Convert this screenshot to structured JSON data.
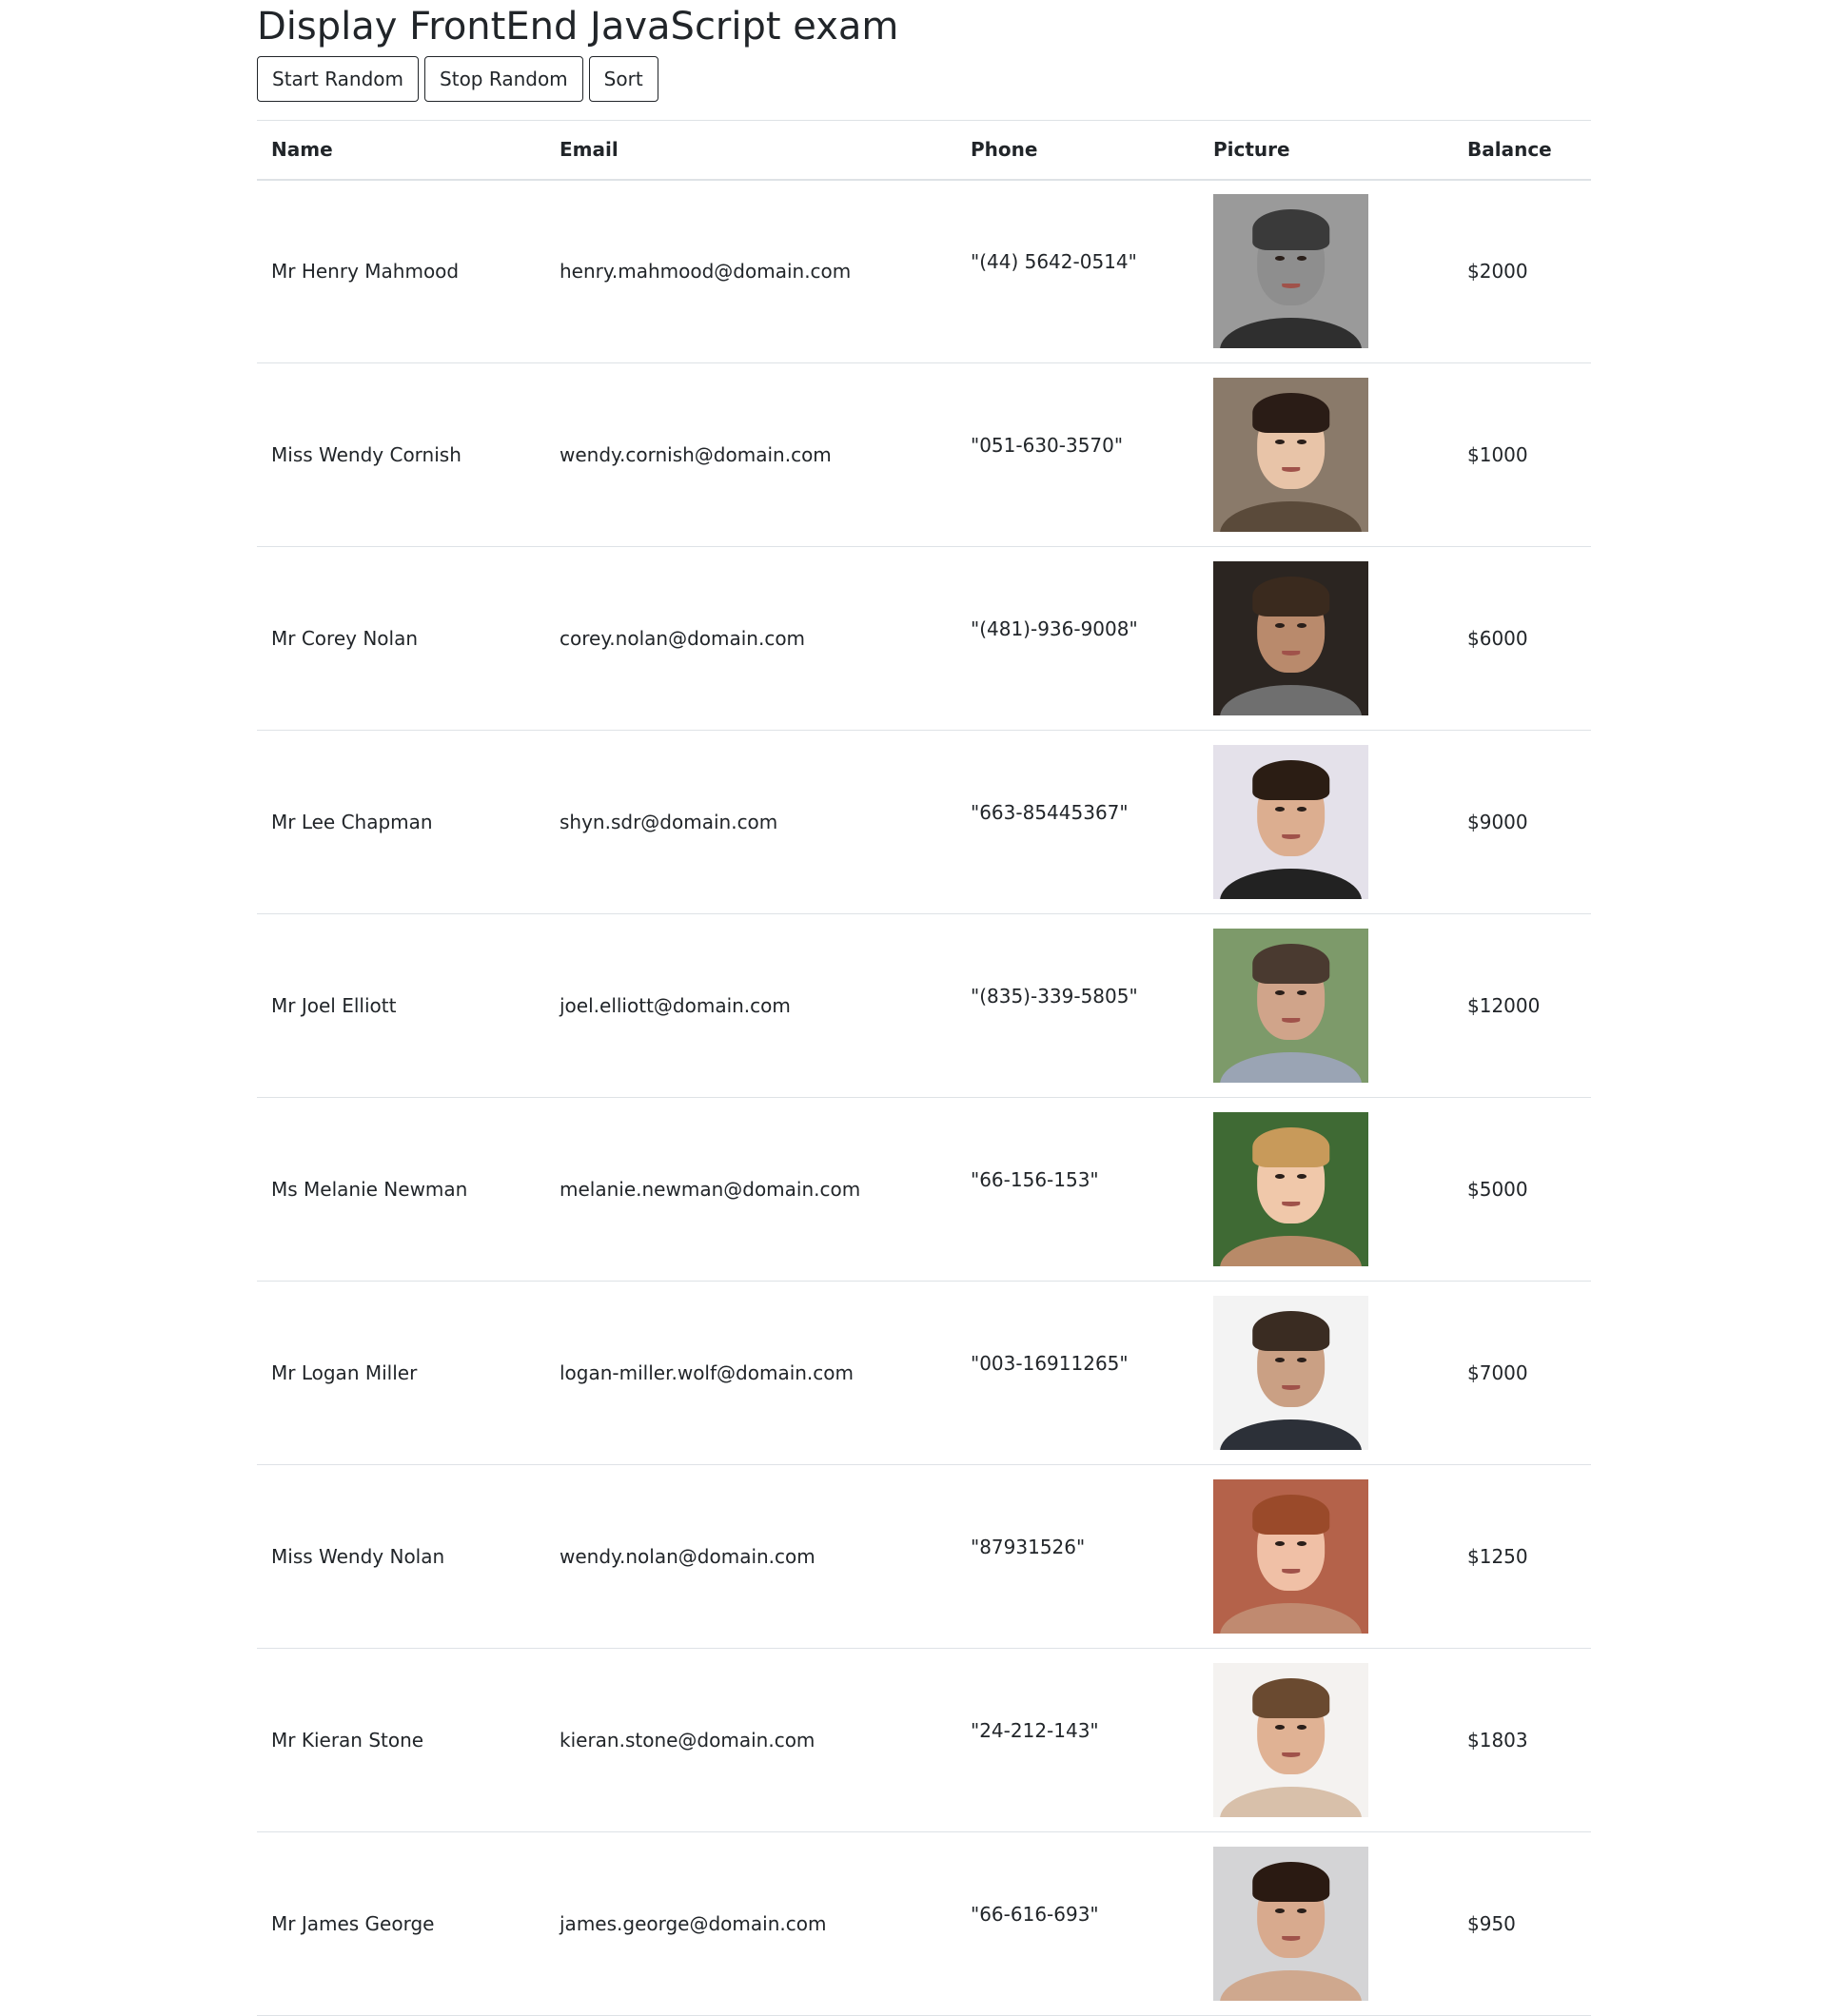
{
  "page": {
    "title": "Display FrontEnd JavaScript exam",
    "buttons": {
      "start_random": "Start Random",
      "stop_random": "Stop Random",
      "sort": "Sort"
    }
  },
  "table": {
    "headers": {
      "name": "Name",
      "email": "Email",
      "phone": "Phone",
      "picture": "Picture",
      "balance": "Balance"
    },
    "rows": [
      {
        "name": "Mr Henry Mahmood",
        "email": "henry.mahmood@domain.com",
        "phone": "\"(44) 5642-0514\"",
        "balance": "$2000",
        "avatar": {
          "bg": "#9a9a9a",
          "skin": "#8e8e8e",
          "hair": "#3a3a3a",
          "shirt": "#2f2f2f"
        }
      },
      {
        "name": "Miss Wendy Cornish",
        "email": "wendy.cornish@domain.com",
        "phone": "\"051-630-3570\"",
        "balance": "$1000",
        "avatar": {
          "bg": "#8a7a6a",
          "skin": "#e8c4a8",
          "hair": "#2a1c16",
          "shirt": "#5a4a3a"
        }
      },
      {
        "name": "Mr Corey Nolan",
        "email": "corey.nolan@domain.com",
        "phone": "\"(481)-936-9008\"",
        "balance": "$6000",
        "avatar": {
          "bg": "#2b2521",
          "skin": "#b98a6c",
          "hair": "#3a2a1e",
          "shirt": "#6f6f6f"
        }
      },
      {
        "name": "Mr Lee Chapman",
        "email": "shyn.sdr@domain.com",
        "phone": "\"663-85445367\"",
        "balance": "$9000",
        "avatar": {
          "bg": "#e4e1ea",
          "skin": "#dcae90",
          "hair": "#2b1d14",
          "shirt": "#222222"
        }
      },
      {
        "name": "Mr Joel Elliott",
        "email": "joel.elliott@domain.com",
        "phone": "\"(835)-339-5805\"",
        "balance": "$12000",
        "avatar": {
          "bg": "#7d9a6a",
          "skin": "#d0a48a",
          "hair": "#4a3a30",
          "shirt": "#9aa4b4"
        }
      },
      {
        "name": "Ms Melanie Newman",
        "email": "melanie.newman@domain.com",
        "phone": "\"66-156-153\"",
        "balance": "$5000",
        "avatar": {
          "bg": "#3f6a34",
          "skin": "#f0c8aa",
          "hair": "#c89a5a",
          "shirt": "#b88a68"
        }
      },
      {
        "name": "Mr Logan Miller",
        "email": "logan-miller.wolf@domain.com",
        "phone": "\"003-16911265\"",
        "balance": "$7000",
        "avatar": {
          "bg": "#f3f3f3",
          "skin": "#caa084",
          "hair": "#3a2c22",
          "shirt": "#2c3038"
        }
      },
      {
        "name": "Miss Wendy Nolan",
        "email": "wendy.nolan@domain.com",
        "phone": "\"87931526\"",
        "balance": "$1250",
        "avatar": {
          "bg": "#b4624a",
          "skin": "#f0c0a6",
          "hair": "#9a4a2a",
          "shirt": "#c08a70"
        }
      },
      {
        "name": "Mr Kieran Stone",
        "email": "kieran.stone@domain.com",
        "phone": "\"24-212-143\"",
        "balance": "$1803",
        "avatar": {
          "bg": "#f4f2f0",
          "skin": "#e0b294",
          "hair": "#6a4a30",
          "shirt": "#d8c0aa"
        }
      },
      {
        "name": "Mr James George",
        "email": "james.george@domain.com",
        "phone": "\"66-616-693\"",
        "balance": "$950",
        "avatar": {
          "bg": "#d4d4d6",
          "skin": "#d8aa8e",
          "hair": "#2a1a12",
          "shirt": "#cfa88e"
        }
      }
    ]
  }
}
